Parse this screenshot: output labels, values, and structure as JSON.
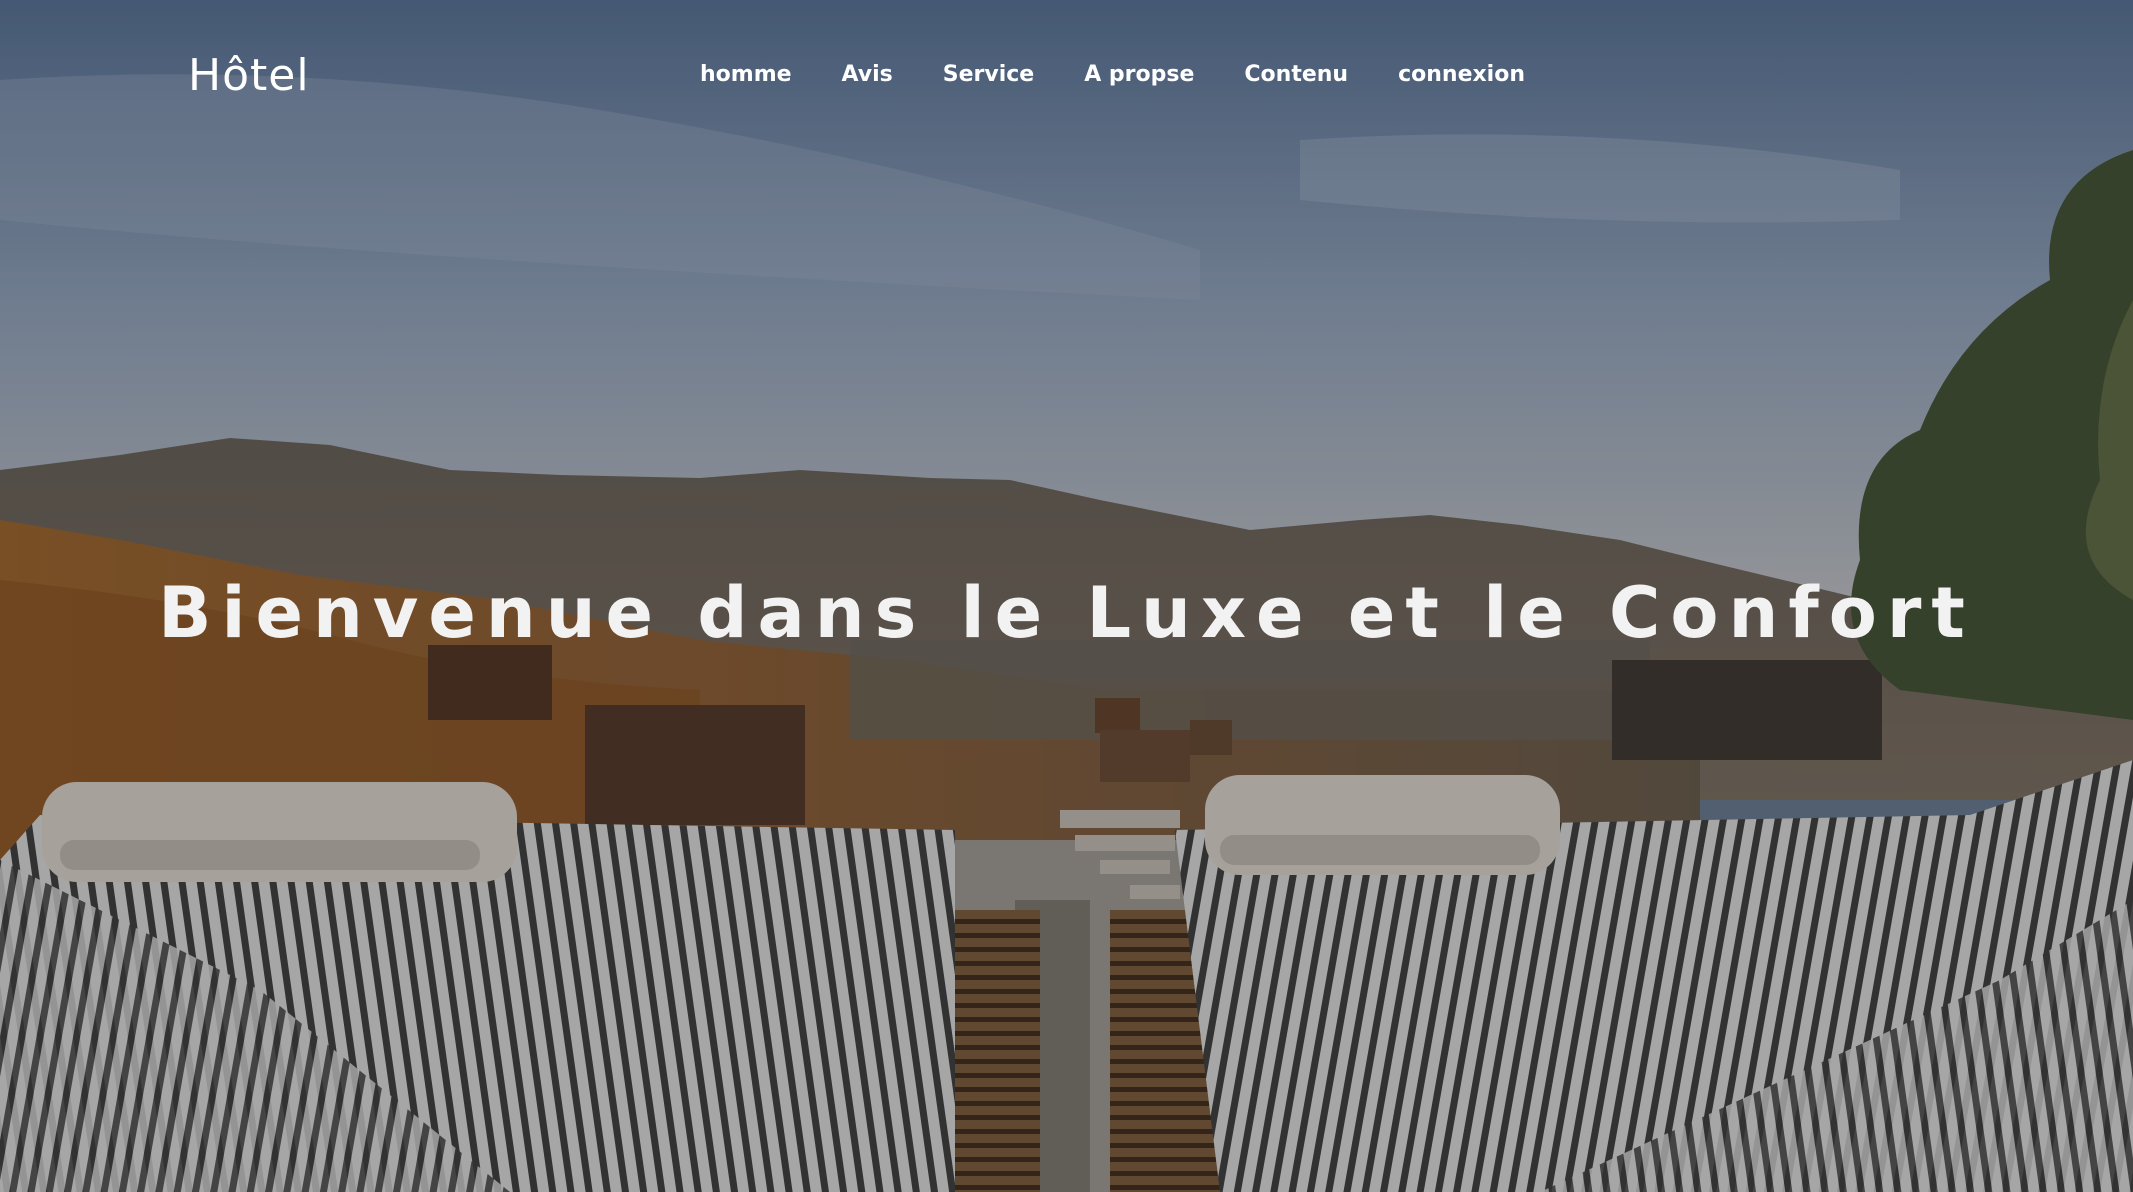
{
  "header": {
    "logo": "Hôtel",
    "nav": [
      {
        "label": "homme"
      },
      {
        "label": "Avis"
      },
      {
        "label": "Service"
      },
      {
        "label": "A propse"
      },
      {
        "label": "Contenu"
      },
      {
        "label": "connexion"
      }
    ]
  },
  "hero": {
    "title": "Bienvenue dans le Luxe et le Confort"
  }
}
